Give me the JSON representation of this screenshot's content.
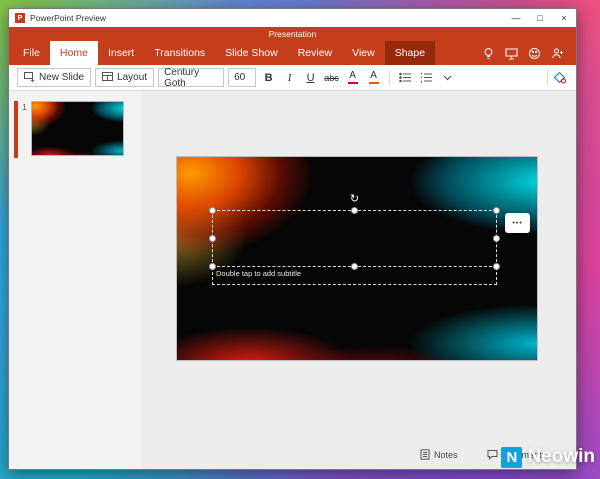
{
  "colors": {
    "brand": "#C43E1C",
    "brand_dark": "#96290C",
    "selection_accent": "#C43E1C",
    "font_color_accent": "#D0021B",
    "neowin_blue": "#0FA2DD"
  },
  "window": {
    "title": "PowerPoint Preview",
    "minimize": "—",
    "maximize": "□",
    "close": "×"
  },
  "header": {
    "document_title": "Presentation"
  },
  "ribbon": {
    "tabs": [
      {
        "label": "File"
      },
      {
        "label": "Home",
        "active": true
      },
      {
        "label": "Insert"
      },
      {
        "label": "Transitions"
      },
      {
        "label": "Slide Show"
      },
      {
        "label": "Review"
      },
      {
        "label": "View"
      },
      {
        "label": "Shape",
        "contextual": true
      }
    ]
  },
  "toolbar": {
    "new_slide": "New Slide",
    "layout": "Layout",
    "font_name": "Century Goth",
    "font_size": "60",
    "bold": "B",
    "italic": "I",
    "underline": "U",
    "strikethrough": "abc",
    "font_color": "A",
    "text_highlight": "A"
  },
  "slides": [
    {
      "number": "1"
    }
  ],
  "slide_editor": {
    "subtitle_placeholder": "Double tap to add subtitle",
    "more_button": "•••",
    "rotate_glyph": "↻"
  },
  "footer": {
    "notes": "Notes",
    "comments": "Comments"
  },
  "watermark": {
    "text": "Neowin"
  }
}
